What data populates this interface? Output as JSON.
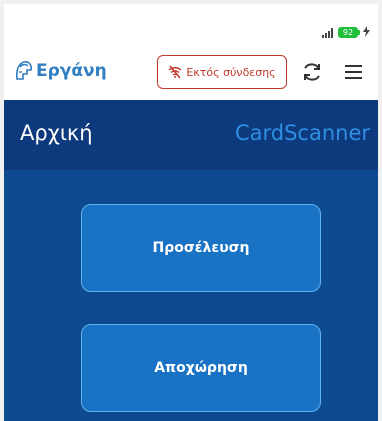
{
  "status_bar": {
    "battery_level": "92",
    "battery_color": "#1fbf3b",
    "charging_icon": "bolt-icon",
    "signal_icon": "signal-bars-icon"
  },
  "header": {
    "logo_text": "Εργάνη",
    "logo_icon": "helmet-logo-icon",
    "offline_label": "Εκτός σύνδεσης",
    "offline_icon": "wifi-off-icon",
    "refresh_icon": "refresh-icon",
    "menu_icon": "hamburger-menu-icon"
  },
  "title_bar": {
    "page_title": "Αρχική",
    "app_name": "CardScanner"
  },
  "main": {
    "arrival_label": "Προσέλευση",
    "departure_label": "Αποχώρηση"
  },
  "colors": {
    "accent": "#2f7ec2",
    "title_bar_bg": "#0d3a7c",
    "main_bg": "#0d4a8f",
    "button_bg": "#1a72c4",
    "button_border": "#5fb4f0",
    "offline_red": "#c0392b"
  }
}
